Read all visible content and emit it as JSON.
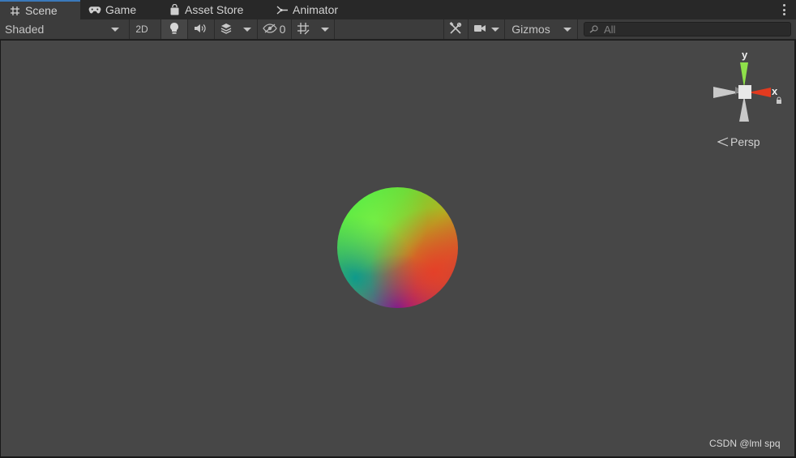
{
  "tabs": [
    {
      "label": "Scene",
      "icon": "grid-icon"
    },
    {
      "label": "Game",
      "icon": "gamepad-icon"
    },
    {
      "label": "Asset Store",
      "icon": "bag-icon"
    },
    {
      "label": "Animator",
      "icon": "animator-icon"
    }
  ],
  "toolbar": {
    "shading_mode": "Shaded",
    "toggle_2d": "2D",
    "hidden_count": "0",
    "gizmos_label": "Gizmos",
    "search_placeholder": "All"
  },
  "scene_gizmo": {
    "y_label": "y",
    "x_label": "x",
    "projection": "Persp"
  },
  "watermark": "CSDN @lml spq",
  "colors": {
    "active_tab_accent": "#3a79bb",
    "viewport_bg": "#474747",
    "axis_y": "#8fe04a",
    "axis_x": "#e23a1f"
  }
}
